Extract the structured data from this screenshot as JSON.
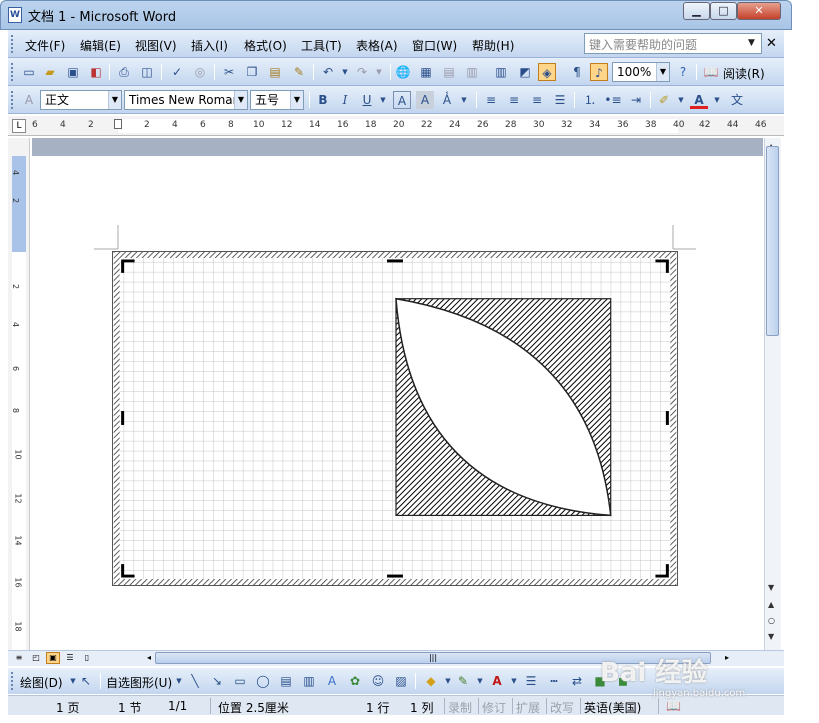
{
  "window": {
    "title": "文档 1 - Microsoft Word",
    "app_icon": "W",
    "min": "▁",
    "max": "□",
    "close": "✕"
  },
  "menu": {
    "items": [
      "文件(F)",
      "编辑(E)",
      "视图(V)",
      "插入(I)",
      "格式(O)",
      "工具(T)",
      "表格(A)",
      "窗口(W)",
      "帮助(H)"
    ],
    "help_placeholder": "键入需要帮助的问题",
    "close_doc": "✕"
  },
  "standard_toolbar": {
    "zoom": "100%",
    "read_label": "阅读(R)"
  },
  "format_toolbar": {
    "style": "正文",
    "font": "Times New Roman",
    "size": "五号",
    "bold": "B",
    "italic": "I",
    "underline": "U",
    "font_color_glyph": "A"
  },
  "ruler": {
    "corner": "L",
    "h_ticks": [
      "6",
      "4",
      "2",
      "",
      "2",
      "4",
      "6",
      "8",
      "10",
      "12",
      "14",
      "16",
      "18",
      "20",
      "22",
      "24",
      "26",
      "28",
      "30",
      "32",
      "34",
      "36",
      "38",
      "40",
      "42",
      "44",
      "46"
    ],
    "v_ticks": [
      "4",
      "2",
      "",
      "2",
      "4",
      "6",
      "8",
      "10",
      "12",
      "14",
      "16",
      "18"
    ]
  },
  "draw_toolbar": {
    "draw_label": "绘图(D)",
    "autoshape_label": "自选图形(U)"
  },
  "status": {
    "page": "1 页",
    "section": "1 节",
    "pages": "1/1",
    "position": "位置 2.5厘米",
    "line": "1 行",
    "column": "1 列",
    "rec": "录制",
    "trk": "修订",
    "ext": "扩展",
    "ovr": "改写",
    "language": "英语(美国)"
  },
  "watermark": {
    "main": "Bai 经验",
    "sub": "jingyan.baidu.com"
  },
  "colors": {
    "accent": "#c3d6ef",
    "page_bg": "#a7b1c4",
    "font_color": "#e02020"
  }
}
